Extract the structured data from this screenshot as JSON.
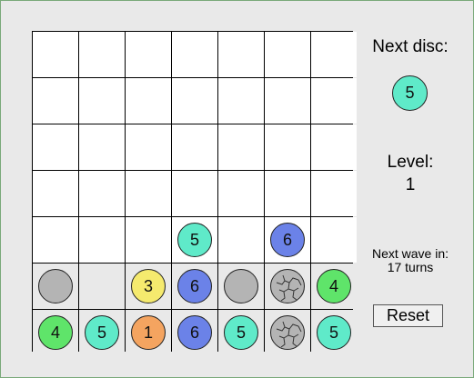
{
  "colors": {
    "1": "#f4a460",
    "3": "#f5ea6e",
    "4": "#5fe46a",
    "5": "#5feac9",
    "6": "#6b82e8",
    "blank": "#b4b4b4",
    "cracked": "#b4b4b4",
    "lit_cell": "#e9e9e9",
    "cell": "#ffffff"
  },
  "board": {
    "rows": 7,
    "cols": 7,
    "highlight_rows": [
      5,
      6
    ],
    "discs": [
      {
        "row": 4,
        "col": 3,
        "kind": "number",
        "value": "5"
      },
      {
        "row": 4,
        "col": 5,
        "kind": "number",
        "value": "6"
      },
      {
        "row": 5,
        "col": 0,
        "kind": "blank"
      },
      {
        "row": 5,
        "col": 2,
        "kind": "number",
        "value": "3"
      },
      {
        "row": 5,
        "col": 3,
        "kind": "number",
        "value": "6"
      },
      {
        "row": 5,
        "col": 4,
        "kind": "blank"
      },
      {
        "row": 5,
        "col": 5,
        "kind": "cracked"
      },
      {
        "row": 5,
        "col": 6,
        "kind": "number",
        "value": "4"
      },
      {
        "row": 6,
        "col": 0,
        "kind": "number",
        "value": "4"
      },
      {
        "row": 6,
        "col": 1,
        "kind": "number",
        "value": "5"
      },
      {
        "row": 6,
        "col": 2,
        "kind": "number",
        "value": "1"
      },
      {
        "row": 6,
        "col": 3,
        "kind": "number",
        "value": "6"
      },
      {
        "row": 6,
        "col": 4,
        "kind": "number",
        "value": "5"
      },
      {
        "row": 6,
        "col": 5,
        "kind": "cracked"
      },
      {
        "row": 6,
        "col": 6,
        "kind": "number",
        "value": "5"
      }
    ]
  },
  "side": {
    "next_label": "Next disc:",
    "next_value": "5",
    "level_label": "Level:",
    "level_value": "1",
    "wave_line1": "Next wave in:",
    "wave_line2": "17 turns",
    "reset_label": "Reset"
  }
}
